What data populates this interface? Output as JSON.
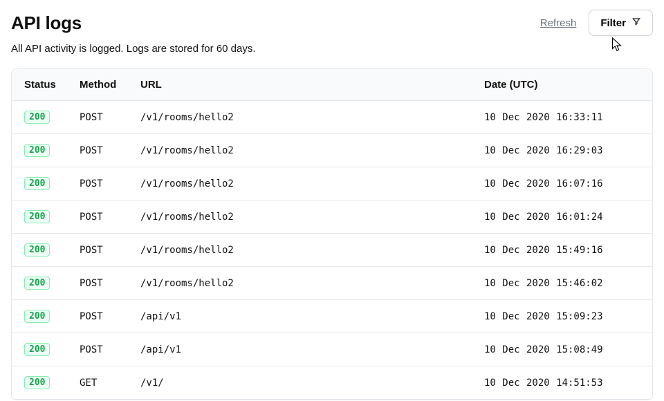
{
  "header": {
    "title": "API logs",
    "refresh_label": "Refresh",
    "filter_label": "Filter"
  },
  "subtitle": "All API activity is logged. Logs are stored for 60 days.",
  "table": {
    "columns": {
      "status": "Status",
      "method": "Method",
      "url": "URL",
      "date": "Date (UTC)"
    },
    "rows": [
      {
        "status": "200",
        "method": "POST",
        "url": "/v1/rooms/hello2",
        "date": "10 Dec 2020 16:33:11"
      },
      {
        "status": "200",
        "method": "POST",
        "url": "/v1/rooms/hello2",
        "date": "10 Dec 2020 16:29:03"
      },
      {
        "status": "200",
        "method": "POST",
        "url": "/v1/rooms/hello2",
        "date": "10 Dec 2020 16:07:16"
      },
      {
        "status": "200",
        "method": "POST",
        "url": "/v1/rooms/hello2",
        "date": "10 Dec 2020 16:01:24"
      },
      {
        "status": "200",
        "method": "POST",
        "url": "/v1/rooms/hello2",
        "date": "10 Dec 2020 15:49:16"
      },
      {
        "status": "200",
        "method": "POST",
        "url": "/v1/rooms/hello2",
        "date": "10 Dec 2020 15:46:02"
      },
      {
        "status": "200",
        "method": "POST",
        "url": "/api/v1",
        "date": "10 Dec 2020 15:09:23"
      },
      {
        "status": "200",
        "method": "POST",
        "url": "/api/v1",
        "date": "10 Dec 2020 15:08:49"
      },
      {
        "status": "200",
        "method": "GET",
        "url": "/v1/",
        "date": "10 Dec 2020 14:51:53"
      }
    ]
  },
  "colors": {
    "status_ok_bg": "#ecfdf5",
    "status_ok_border": "#86efac",
    "status_ok_text": "#16a34a"
  }
}
